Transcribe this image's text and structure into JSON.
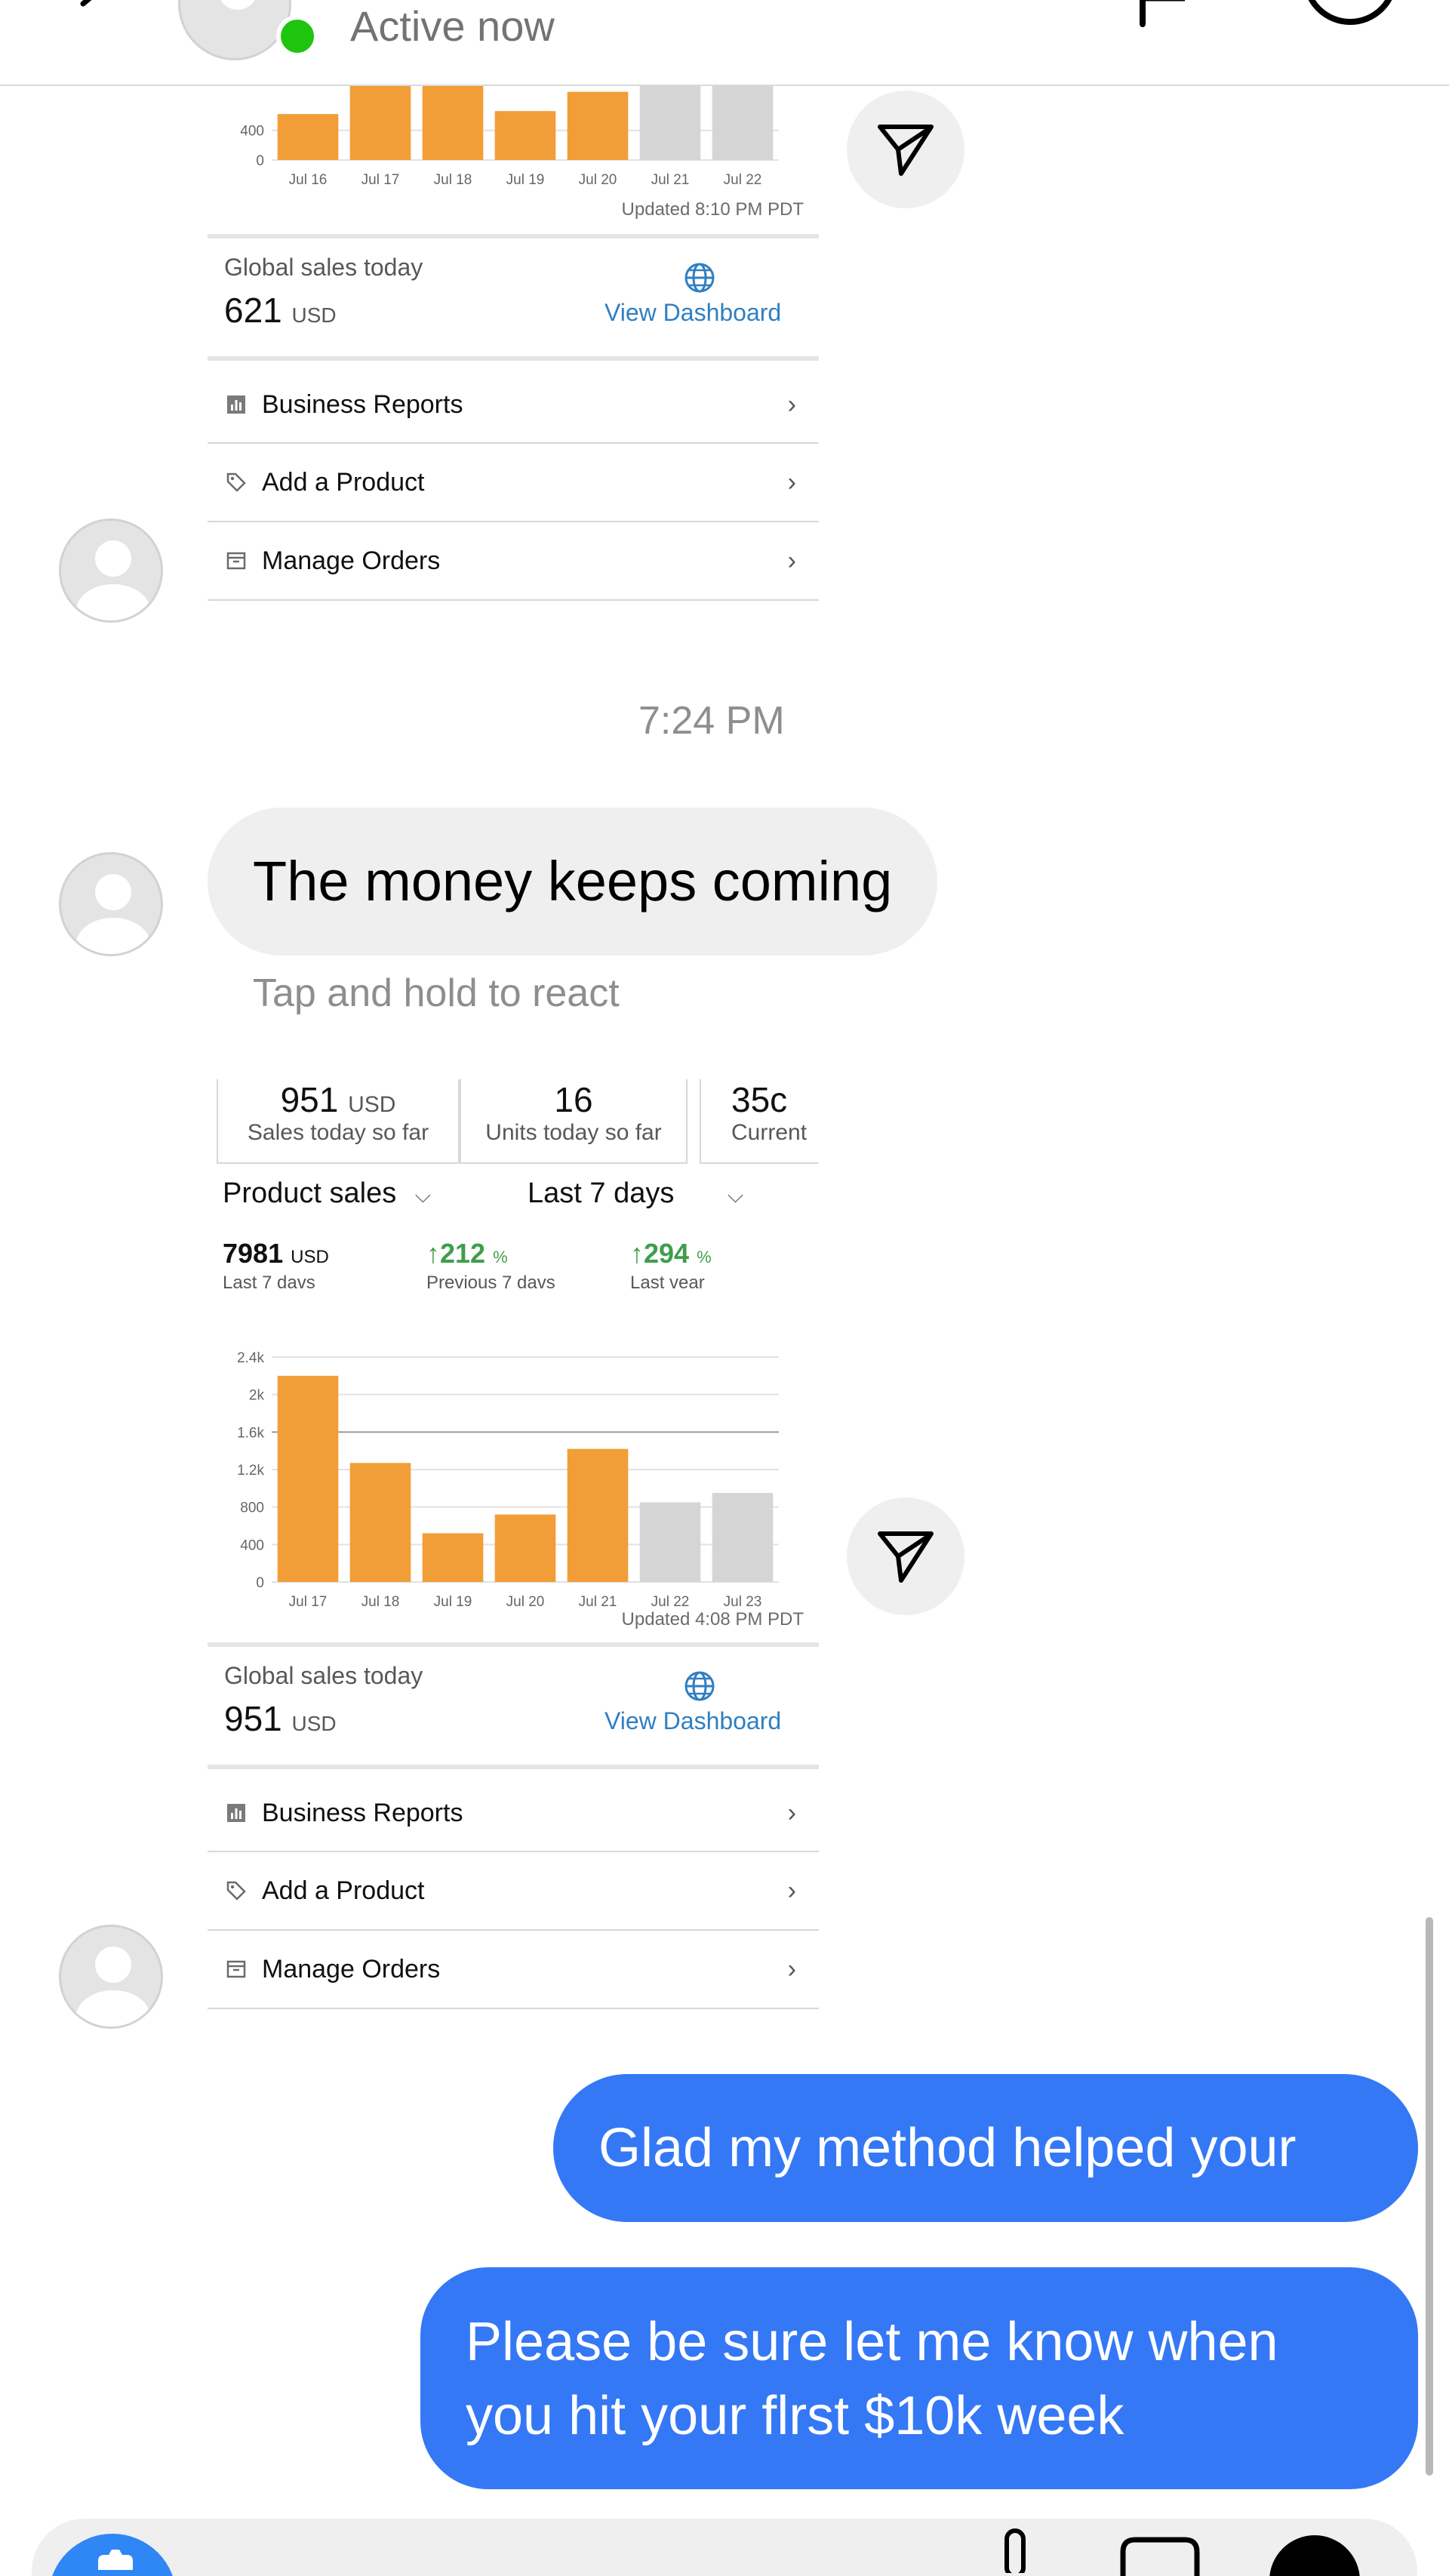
{
  "header": {
    "status_text": "Active now",
    "active_dot_color": "#1fc40e"
  },
  "dashboard1": {
    "chart_data": {
      "type": "bar",
      "categories": [
        "Jul 16",
        "Jul 17",
        "Jul 18",
        "Jul 19",
        "Jul 20",
        "Jul 21",
        "Jul 22"
      ],
      "values": [
        620,
        1000,
        1000,
        660,
        920,
        1000,
        1000
      ],
      "projected": [
        false,
        false,
        false,
        false,
        false,
        true,
        true
      ],
      "visible_y_ticks": [
        "400",
        "0"
      ],
      "ylim": [
        0,
        1100
      ],
      "colors": {
        "actual": "#f19e38",
        "projected": "#d5d5d5"
      }
    },
    "updated": "Updated 8:10 PM PDT",
    "global_label": "Global sales today",
    "global_value": "621",
    "global_unit": "USD",
    "view_dashboard": "View Dashboard",
    "menu": [
      {
        "label": "Business Reports",
        "icon": "bar-chart-icon"
      },
      {
        "label": "Add a Product",
        "icon": "tag-icon"
      },
      {
        "label": "Manage Orders",
        "icon": "order-box-icon"
      }
    ]
  },
  "timestamp": "7:24 PM",
  "incoming_message": "The money keeps coming",
  "react_hint": "Tap and hold to react",
  "dashboard2": {
    "stats": [
      {
        "value": "951",
        "unit": "USD",
        "label": "Sales today so far"
      },
      {
        "value": "16",
        "unit": "",
        "label": "Units today so far"
      },
      {
        "value": "35с",
        "unit": "",
        "label": "Current"
      }
    ],
    "filter_metric": "Product sales",
    "filter_range": "Last 7 days",
    "summary": [
      {
        "value": "7981",
        "unit": "USD",
        "label": "Last 7 davs"
      },
      {
        "value": "↑212",
        "unit": "%",
        "label": "Previous 7 davs"
      },
      {
        "value": "↑294",
        "unit": "%",
        "label": "Last vear"
      }
    ],
    "chart_data": {
      "type": "bar",
      "categories": [
        "Jul 17",
        "Jul 18",
        "Jul 19",
        "Jul 20",
        "Jul 21",
        "Jul 22",
        "Jul 23"
      ],
      "values": [
        2200,
        1270,
        520,
        720,
        1420,
        850,
        950
      ],
      "projected": [
        false,
        false,
        false,
        false,
        false,
        true,
        true
      ],
      "y_ticks": [
        "2.4k",
        "2k",
        "1.6k",
        "1.2k",
        "800",
        "400",
        "0"
      ],
      "ylim": [
        0,
        2400
      ],
      "colors": {
        "actual": "#f19e38",
        "projected": "#d5d5d5"
      }
    },
    "updated": "Updated 4:08 PM PDT",
    "global_label": "Global sales today",
    "global_value": "951",
    "global_unit": "USD",
    "view_dashboard": "View Dashboard",
    "menu": [
      {
        "label": "Business Reports",
        "icon": "bar-chart-icon"
      },
      {
        "label": "Add a Product",
        "icon": "tag-icon"
      },
      {
        "label": "Manage Orders",
        "icon": "order-box-icon"
      }
    ]
  },
  "outgoing": [
    {
      "text": "Glad my method helped your"
    },
    {
      "line1": "Please be sure let me know when",
      "line2": "you hit your flrst $10k week"
    }
  ],
  "colors": {
    "outgoing_bubble": "#3478f6",
    "incoming_bubble": "#efefef",
    "link": "#2f7fc1",
    "positive": "#3f9e4b"
  }
}
